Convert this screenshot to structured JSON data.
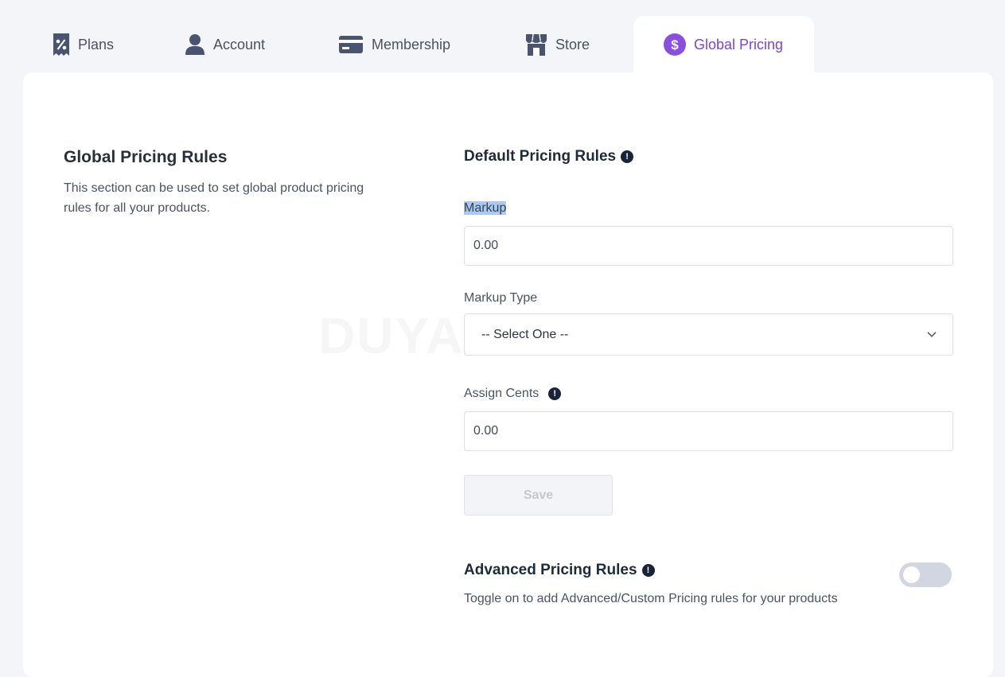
{
  "tabs": [
    {
      "label": "Plans",
      "icon": "receipt-percent-icon"
    },
    {
      "label": "Account",
      "icon": "user-icon"
    },
    {
      "label": "Membership",
      "icon": "credit-card-icon"
    },
    {
      "label": "Store",
      "icon": "store-icon"
    },
    {
      "label": "Global Pricing",
      "icon": "dollar-circle-icon",
      "active": true
    }
  ],
  "left": {
    "title": "Global Pricing Rules",
    "description": "This section can be used to set global product pricing rules for all your products."
  },
  "default_rules": {
    "title": "Default Pricing Rules",
    "markup_label": "Markup",
    "markup_value": "0.00",
    "markup_type_label": "Markup Type",
    "markup_type_selected": "-- Select One --",
    "assign_cents_label": "Assign Cents",
    "assign_cents_value": "0.00",
    "save_label": "Save"
  },
  "advanced_rules": {
    "title": "Advanced Pricing Rules",
    "description": "Toggle on to add Advanced/Custom Pricing rules for your products",
    "enabled": false
  },
  "watermark": "DUYALEX.COM",
  "colors": {
    "accent": "#7b45d6",
    "icon": "#4a5470",
    "background": "#f4f5f9"
  }
}
